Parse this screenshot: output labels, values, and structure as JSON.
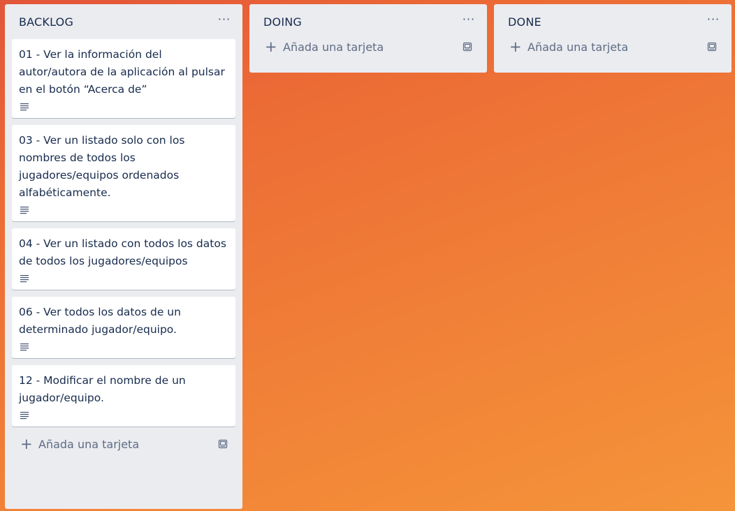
{
  "lists": [
    {
      "title": "BACKLOG",
      "add_card_label": "Añada una tarjeta",
      "cards": [
        {
          "title": "01 - Ver la información del autor/autora de la aplicación al pulsar en el botón “Acerca de”"
        },
        {
          "title": "03 - Ver un listado solo con los nombres de todos los jugadores/equipos ordenados alfabéticamente."
        },
        {
          "title": "04 - Ver un listado con todos los datos de todos los jugadores/equipos"
        },
        {
          "title": "06 - Ver todos los datos de un determinado jugador/equipo."
        },
        {
          "title": "12 - Modificar el nombre de un jugador/equipo."
        }
      ]
    },
    {
      "title": "DOING",
      "add_card_label": "Añada una tarjeta",
      "cards": []
    },
    {
      "title": "DONE",
      "add_card_label": "Añada una tarjeta",
      "cards": []
    }
  ],
  "icons": {
    "list_menu": "ellipsis-icon",
    "card_badge": "description-icon",
    "add": "plus-icon",
    "template": "card-template-icon"
  },
  "colors": {
    "list_bg": "#ebecf0",
    "card_bg": "#ffffff",
    "text": "#172b4d",
    "muted": "#5e6c84",
    "board_gradient_start": "#e2553a",
    "board_gradient_end": "#f5943a"
  }
}
